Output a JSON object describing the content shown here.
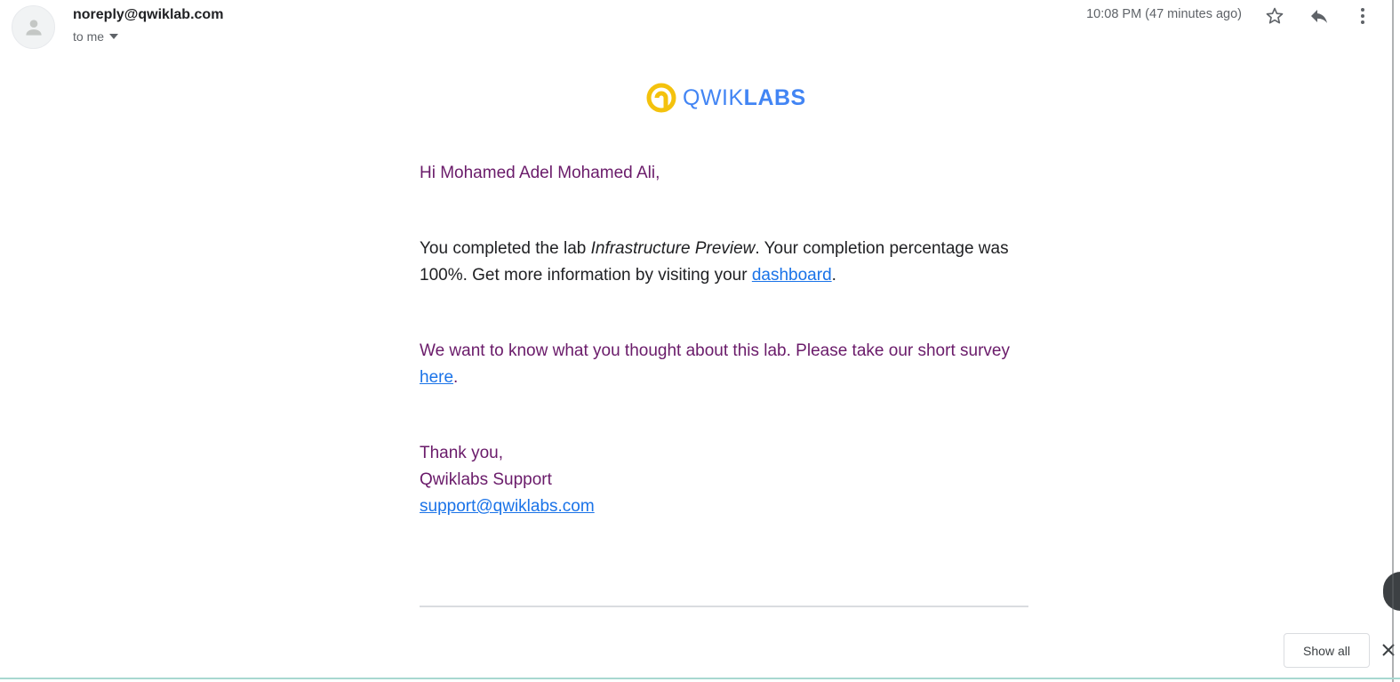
{
  "header": {
    "sender": "noreply@qwiklab.com",
    "recipient": "to me",
    "time": "10:08 PM (47 minutes ago)"
  },
  "logo": {
    "text_light": "QWIK",
    "text_bold": "LABS",
    "colors": {
      "ring": "#f4c20d",
      "text": "#4285f4"
    }
  },
  "body": {
    "greeting": "Hi Mohamed Adel Mohamed Ali,",
    "p1_pre": "You completed the lab ",
    "lab_name": "Infrastructure Preview",
    "p1_post": ". Your completion percentage was 100%. Get more information by visiting your ",
    "dashboard_link": "dashboard",
    "period": ".",
    "p2_pre": "We want to know what you thought about this lab. Please take our short survey ",
    "survey_link": "here",
    "signoff": "Thank you,",
    "team": "Qwiklabs Support",
    "support_email": "support@qwiklabs.com"
  },
  "downloads_bar": {
    "show_all": "Show all"
  },
  "icons": {
    "avatar": "person-icon",
    "star": "star-icon",
    "reply": "reply-icon",
    "more": "more-vert-icon",
    "dropdown": "caret-down-icon",
    "close": "close-icon"
  },
  "colors": {
    "purple_text": "#6a1b6a",
    "link": "#1a73e8"
  }
}
